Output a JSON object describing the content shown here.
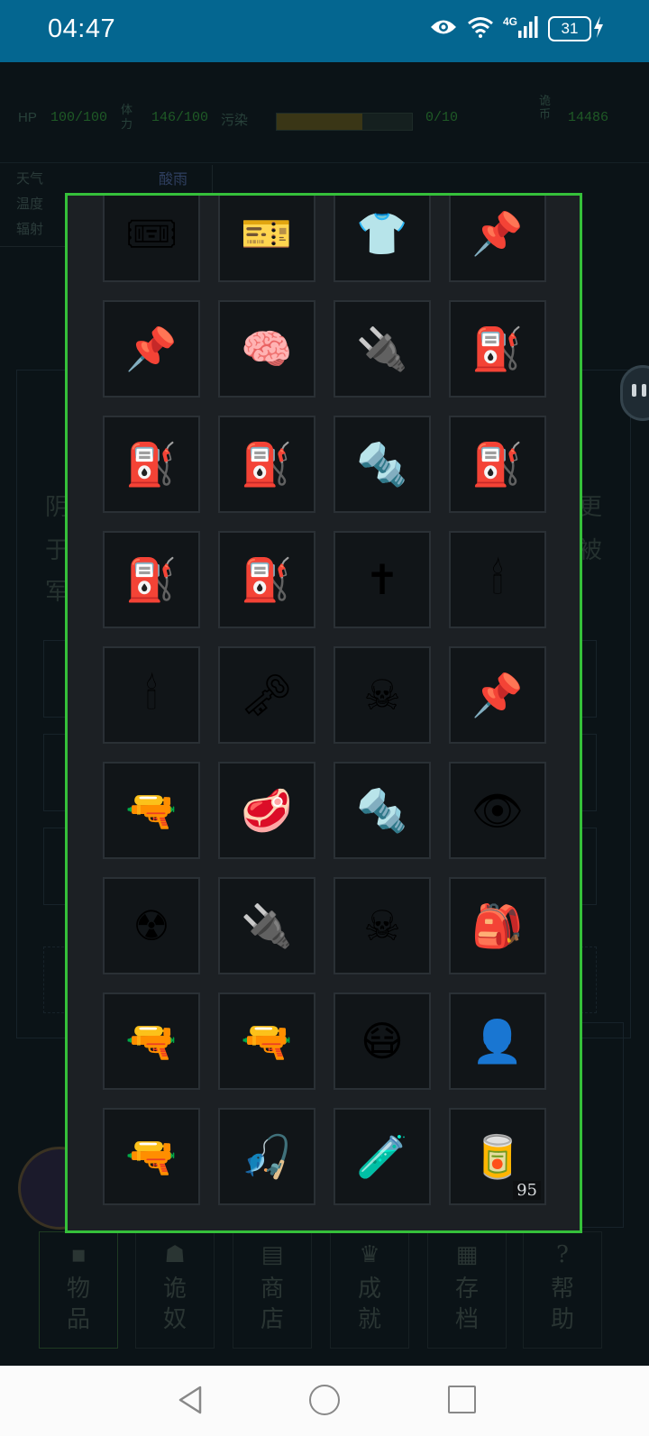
{
  "status_bar": {
    "time": "04:47",
    "battery": "31",
    "network": "4G",
    "icons": [
      "eye-icon",
      "wifi-icon",
      "signal-icon",
      "battery-icon",
      "charging-icon"
    ]
  },
  "stats": {
    "hp_label": "HP",
    "hp_value": "100/100",
    "stamina_label": "体力",
    "stamina_value": "146/100",
    "progress_label": "污染",
    "progress_value": "0/10",
    "progress_fill": 0.63,
    "coin_label": "诡币",
    "coin_value": "14486"
  },
  "weather": {
    "label1": "天气",
    "value1": "酸雨",
    "label2": "温度",
    "label3": "辐射"
  },
  "background_text": {
    "left": [
      "阴",
      "于",
      "军"
    ],
    "right": [
      "更",
      "被"
    ]
  },
  "inventory": {
    "items": [
      {
        "icon": "🎟",
        "name": "admit-one-ticket-icon"
      },
      {
        "icon": "🎫",
        "name": "ticket-icon"
      },
      {
        "icon": "👕",
        "name": "tshirt-icon"
      },
      {
        "icon": "📌",
        "name": "pushpin-icon"
      },
      {
        "icon": "📌",
        "name": "pushpin-icon"
      },
      {
        "icon": "🧠",
        "name": "brain-icon"
      },
      {
        "icon": "🔌",
        "name": "plug-icon"
      },
      {
        "icon": "⛽",
        "name": "fuel-pump-icon"
      },
      {
        "icon": "⛽",
        "name": "fuel-pump-icon"
      },
      {
        "icon": "⛽",
        "name": "fuel-pump-icon"
      },
      {
        "icon": "🔩",
        "name": "nut-bolt-icon"
      },
      {
        "icon": "⛽",
        "name": "fuel-pump-icon"
      },
      {
        "icon": "⛽",
        "name": "fuel-pump-icon"
      },
      {
        "icon": "⛽",
        "name": "fuel-pump-icon"
      },
      {
        "icon": "✝",
        "name": "cross-icon"
      },
      {
        "icon": "🕯",
        "name": "candle-icon"
      },
      {
        "icon": "🕯",
        "name": "candle-icon"
      },
      {
        "icon": "🗝",
        "name": "old-key-icon"
      },
      {
        "icon": "☠",
        "name": "skull-crossbones-icon"
      },
      {
        "icon": "📌",
        "name": "pushpin-icon"
      },
      {
        "icon": "🔫",
        "name": "water-pistol-icon"
      },
      {
        "icon": "🥩",
        "name": "meat-icon"
      },
      {
        "icon": "🔩",
        "name": "nut-bolt-icon"
      },
      {
        "icon": "👁",
        "name": "eye-icon"
      },
      {
        "icon": "☢",
        "name": "radioactive-icon"
      },
      {
        "icon": "🔌",
        "name": "plug-icon"
      },
      {
        "icon": "☠",
        "name": "skull-crossbones-icon"
      },
      {
        "icon": "🎒",
        "name": "backpack-icon"
      },
      {
        "icon": "🔫",
        "name": "water-pistol-icon"
      },
      {
        "icon": "🔫",
        "name": "water-pistol-icon"
      },
      {
        "icon": "😷",
        "name": "mask-face-icon"
      },
      {
        "icon": "👤",
        "name": "silhouette-icon"
      },
      {
        "icon": "🔫",
        "name": "water-pistol-icon"
      },
      {
        "icon": "🎣",
        "name": "fishing-pole-icon"
      },
      {
        "icon": "🧪",
        "name": "test-tube-icon"
      },
      {
        "icon": "🥫",
        "name": "canned-food-icon",
        "count": "95"
      }
    ]
  },
  "bottom_tabs": [
    {
      "label": "物品",
      "icon": "box-icon"
    },
    {
      "label": "诡奴",
      "icon": "ghost-icon"
    },
    {
      "label": "商店",
      "icon": "shop-icon"
    },
    {
      "label": "成就",
      "icon": "trophy-icon"
    },
    {
      "label": "存档",
      "icon": "save-icon"
    },
    {
      "label": "帮助",
      "icon": "question-icon"
    }
  ]
}
